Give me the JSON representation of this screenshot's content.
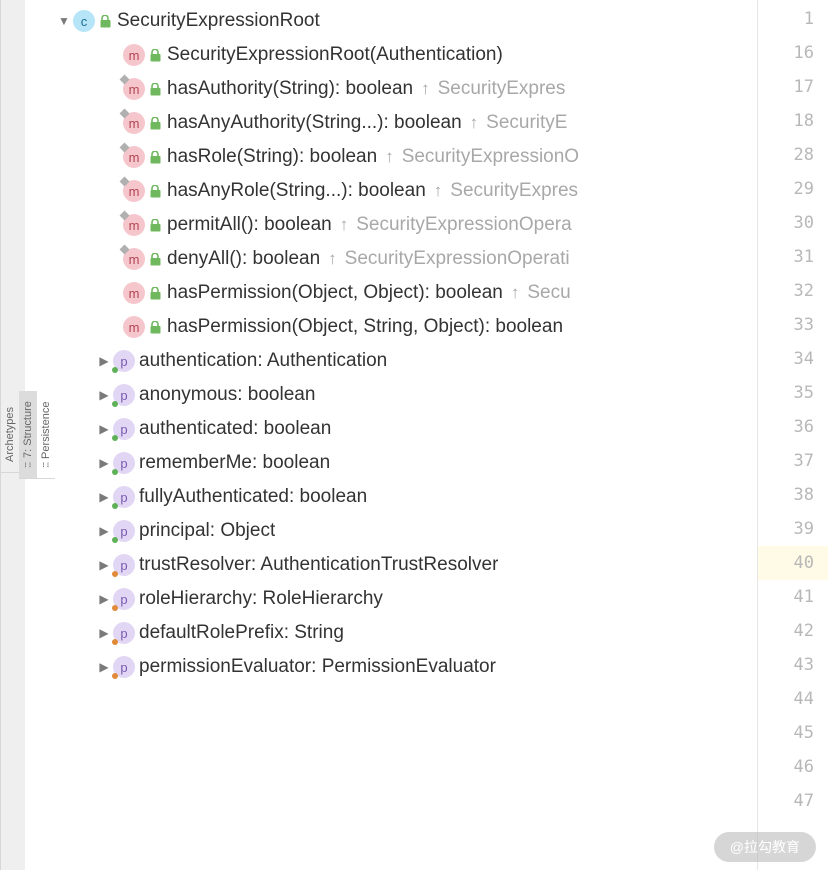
{
  "sidebar": {
    "tabs": [
      {
        "label": "Archetypes",
        "active": false
      },
      {
        "label": "7: Structure",
        "active": true,
        "dots": ":::"
      },
      {
        "label": "Persistence",
        "active": false,
        "dots": ":::"
      }
    ]
  },
  "tree": {
    "root": {
      "badge": "c",
      "label": "SecurityExpressionRoot",
      "expanded": true
    },
    "methods": [
      {
        "badge": "m",
        "corner": false,
        "label": "SecurityExpressionRoot(Authentication)",
        "origin": ""
      },
      {
        "badge": "m",
        "corner": true,
        "label": "hasAuthority(String): boolean",
        "origin": "SecurityExpres"
      },
      {
        "badge": "m",
        "corner": true,
        "label": "hasAnyAuthority(String...): boolean",
        "origin": "SecurityE"
      },
      {
        "badge": "m",
        "corner": true,
        "label": "hasRole(String): boolean",
        "origin": "SecurityExpressionO"
      },
      {
        "badge": "m",
        "corner": true,
        "label": "hasAnyRole(String...): boolean",
        "origin": "SecurityExpres"
      },
      {
        "badge": "m",
        "corner": true,
        "label": "permitAll(): boolean",
        "origin": "SecurityExpressionOpera"
      },
      {
        "badge": "m",
        "corner": true,
        "label": "denyAll(): boolean",
        "origin": "SecurityExpressionOperati"
      },
      {
        "badge": "m",
        "corner": false,
        "label": "hasPermission(Object, Object): boolean",
        "origin": "Secu"
      },
      {
        "badge": "m",
        "corner": false,
        "label": "hasPermission(Object, String, Object): boolean",
        "origin": ""
      }
    ],
    "props": [
      {
        "badge": "p",
        "dot": "green",
        "label": "authentication: Authentication"
      },
      {
        "badge": "p",
        "dot": "green",
        "label": "anonymous: boolean"
      },
      {
        "badge": "p",
        "dot": "green",
        "label": "authenticated: boolean"
      },
      {
        "badge": "p",
        "dot": "green",
        "label": "rememberMe: boolean"
      },
      {
        "badge": "p",
        "dot": "green",
        "label": "fullyAuthenticated: boolean"
      },
      {
        "badge": "p",
        "dot": "green",
        "label": "principal: Object"
      },
      {
        "badge": "p",
        "dot": "orange",
        "label": "trustResolver: AuthenticationTrustResolver"
      },
      {
        "badge": "p",
        "dot": "orange",
        "label": "roleHierarchy: RoleHierarchy"
      },
      {
        "badge": "p",
        "dot": "orange",
        "label": "defaultRolePrefix: String"
      },
      {
        "badge": "p",
        "dot": "orange",
        "label": "permissionEvaluator: PermissionEvaluator"
      }
    ]
  },
  "gutter": {
    "lines": [
      1,
      16,
      17,
      18,
      28,
      29,
      30,
      31,
      32,
      33,
      34,
      35,
      36,
      37,
      38,
      39,
      40,
      41,
      42,
      43,
      44,
      45,
      46,
      47
    ],
    "highlight": 40
  },
  "watermark": "@拉勾教育"
}
